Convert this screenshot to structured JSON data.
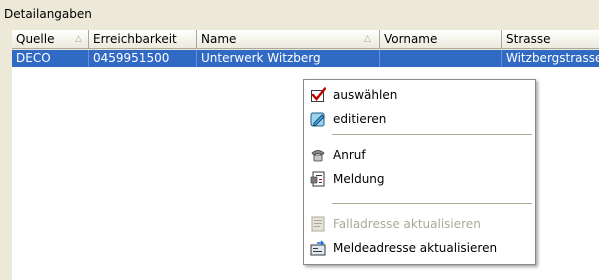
{
  "panel": {
    "title": "Detailangaben"
  },
  "grid": {
    "columns": [
      {
        "label": "Quelle",
        "sorted": true
      },
      {
        "label": "Erreichbarkeit",
        "sorted": false
      },
      {
        "label": "Name",
        "sorted": true
      },
      {
        "label": "Vorname",
        "sorted": false
      },
      {
        "label": "Strasse",
        "sorted": false
      }
    ],
    "rows": [
      {
        "quelle": "DECO",
        "erreichbarkeit": "0459951500",
        "name": "Unterwerk Witzberg",
        "vorname": "",
        "strasse": "Witzbergstrasse"
      }
    ]
  },
  "context_menu": {
    "items": [
      {
        "label": "auswählen",
        "icon": "checkbox-checked-icon",
        "enabled": true
      },
      {
        "label": "editieren",
        "icon": "edit-pencil-icon",
        "enabled": true
      },
      {
        "label": "Anruf",
        "icon": "telephone-icon",
        "enabled": true
      },
      {
        "label": "Meldung",
        "icon": "report-document-icon",
        "enabled": true
      },
      {
        "label": "Falladresse aktualisieren",
        "icon": "address-card-icon",
        "enabled": false
      },
      {
        "label": "Meldeadresse aktualisieren",
        "icon": "address-update-icon",
        "enabled": true
      }
    ]
  },
  "colors": {
    "selection": "#316ac5",
    "panel": "#ece9d8",
    "disabled_text": "#aca899"
  }
}
